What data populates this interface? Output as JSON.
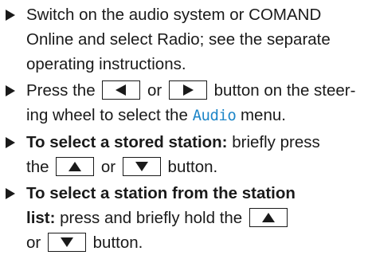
{
  "steps": [
    {
      "text": "Switch on the audio system or COMAND Online and select Radio; see the separate operating instructions."
    },
    {
      "pre": "Press the",
      "or": "or",
      "post": "button on the steer-",
      "post2": "ing wheel to select the",
      "menu_name": "Audio",
      "post3": "menu."
    },
    {
      "bold": "To select a stored station:",
      "text": "briefly press",
      "the": "the",
      "or": "or",
      "post": "button."
    },
    {
      "bold": "To select a station from the station",
      "bold2": "list:",
      "text": "press and briefly hold the",
      "or": "or",
      "post": "button."
    }
  ],
  "icons": {
    "bullet": "triangle-right-bullet",
    "left_key": "arrow-left-key",
    "right_key": "arrow-right-key",
    "up_key": "arrow-up-key",
    "down_key": "arrow-down-key"
  },
  "colors": {
    "text": "#1a1a1a",
    "menu_accent": "#1e86c8"
  }
}
